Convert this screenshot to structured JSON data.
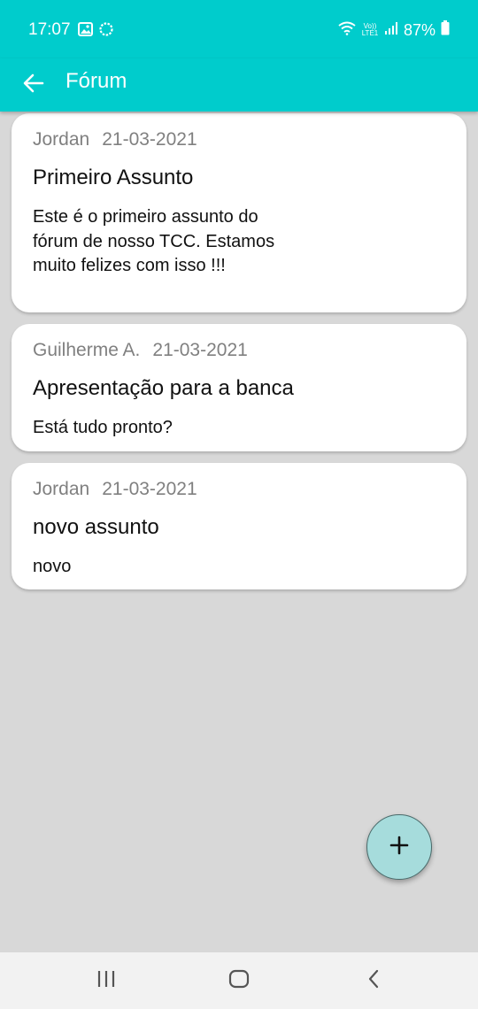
{
  "status_bar": {
    "time": "17:07",
    "battery": "87%",
    "left_icons": [
      "image-icon",
      "sync-icon"
    ],
    "right_icons": [
      "wifi-icon",
      "volte-icon",
      "signal-icon",
      "battery-icon"
    ],
    "volte_label": "Vo)) LTE1"
  },
  "app_bar": {
    "title": "Fórum",
    "back_icon": "arrow-left-icon",
    "background": "#00cccc"
  },
  "posts": [
    {
      "author": "Jordan",
      "date": "21-03-2021",
      "title": "Primeiro Assunto",
      "body": "Este é o primeiro assunto do fórum de nosso TCC. Estamos muito felizes com isso !!!"
    },
    {
      "author": "Guilherme A.",
      "date": "21-03-2021",
      "title": "Apresentação para a banca",
      "body": "Está tudo pronto?"
    },
    {
      "author": "Jordan",
      "date": "21-03-2021",
      "title": "novo assunto",
      "body": "novo"
    }
  ],
  "fab": {
    "icon": "plus-icon",
    "color": "#a6dcdc"
  },
  "nav_bar": {
    "buttons": [
      "recents-icon",
      "home-icon",
      "back-icon"
    ]
  }
}
